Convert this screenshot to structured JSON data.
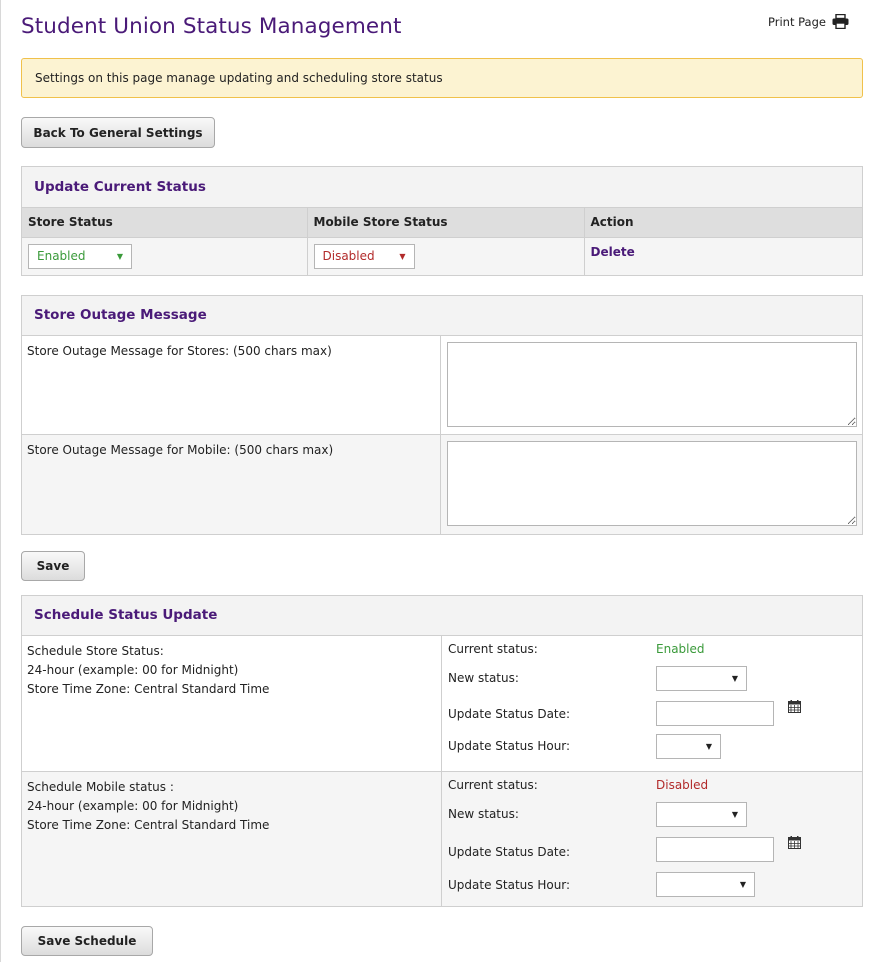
{
  "page": {
    "title": "Student Union Status Management",
    "print_label": "Print Page",
    "notice": "Settings on this page manage updating and scheduling store status",
    "back_button": "Back To General Settings"
  },
  "update_status": {
    "header": "Update Current Status",
    "columns": [
      "Store Status",
      "Mobile Store Status",
      "Action"
    ],
    "store_status": "Enabled",
    "mobile_status": "Disabled",
    "action": "Delete"
  },
  "outage": {
    "header": "Store Outage Message",
    "stores_label": "Store Outage Message for Stores: (500 chars max)",
    "mobile_label": "Store Outage Message for Mobile: (500 chars max)",
    "stores_value": "",
    "mobile_value": "",
    "save_button": "Save"
  },
  "schedule": {
    "header": "Schedule Status Update",
    "store": {
      "line1": "Schedule Store Status:",
      "line2": "24-hour (example: 00 for Midnight)",
      "line3": "Store Time Zone: Central Standard Time",
      "current_label": "Current status:",
      "current_value": "Enabled",
      "new_label": "New status:",
      "new_value": "",
      "date_label": "Update Status Date:",
      "date_value": "",
      "hour_label": "Update Status Hour:",
      "hour_value": ""
    },
    "mobile": {
      "line1": "Schedule Mobile status :",
      "line2": "24-hour (example: 00 for Midnight)",
      "line3": "Store Time Zone: Central Standard Time",
      "current_label": "Current status:",
      "current_value": "Disabled",
      "new_label": "New status:",
      "new_value": "",
      "date_label": "Update Status Date:",
      "date_value": "",
      "hour_label": "Update Status Hour:",
      "hour_value": ""
    },
    "save_button": "Save Schedule"
  },
  "colors": {
    "title": "#4a1a78",
    "enabled": "#3a9a3a",
    "disabled": "#b22a2a",
    "notice_bg": "#fcf3d2",
    "notice_border": "#f0c14b"
  },
  "icons": [
    "printer-icon",
    "calendar-icon",
    "chevron-down-icon"
  ]
}
